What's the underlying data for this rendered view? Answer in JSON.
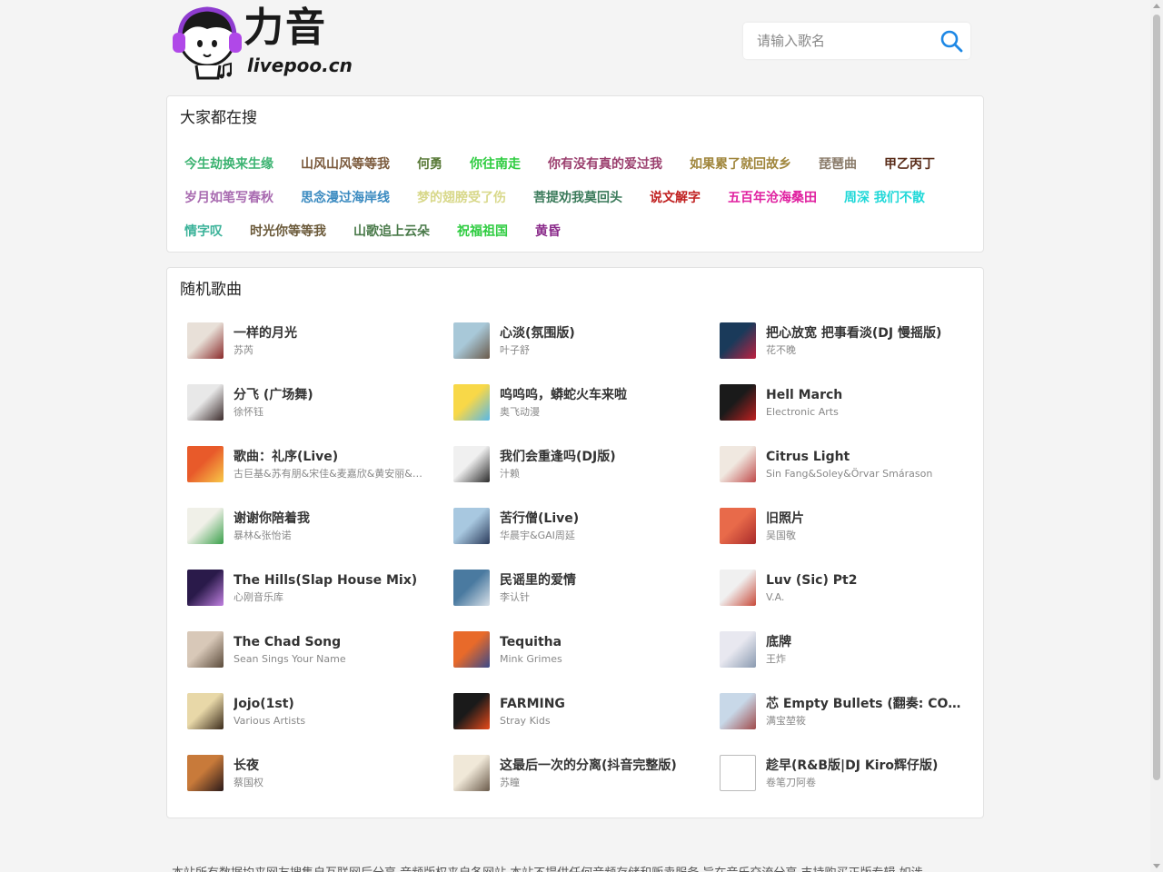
{
  "logo": {
    "title": "力音",
    "subtitle": "livepoo.cn"
  },
  "search": {
    "placeholder": "请输入歌名",
    "icon": "search-icon",
    "icon_color": "#1e88e5"
  },
  "hot": {
    "title": "大家都在搜",
    "rows": [
      [
        {
          "label": "今生劫换来生缘",
          "color": "#3cb371"
        },
        {
          "label": "山风山风等等我",
          "color": "#7b5a3c"
        },
        {
          "label": "何勇",
          "color": "#5b7b3a"
        },
        {
          "label": "你往南走",
          "color": "#2ecc40"
        },
        {
          "label": "你有没有真的爱过我",
          "color": "#9b3f6e"
        },
        {
          "label": "如果累了就回故乡",
          "color": "#a0863c"
        },
        {
          "label": "琵琶曲",
          "color": "#8a7b6a"
        },
        {
          "label": "甲乙丙丁",
          "color": "#5a2d1a"
        }
      ],
      [
        {
          "label": "岁月如笔写春秋",
          "color": "#a86ab0"
        },
        {
          "label": "思念漫过海岸线",
          "color": "#3a8ac0"
        },
        {
          "label": "梦的翅膀受了伤",
          "color": "#d8d88a"
        },
        {
          "label": "菩提劝我莫回头",
          "color": "#3a7a5a"
        },
        {
          "label": "说文解字",
          "color": "#c02020"
        },
        {
          "label": "五百年沧海桑田",
          "color": "#e020a0"
        },
        {
          "label": "周深 我们不散",
          "color": "#20d8d8"
        }
      ],
      [
        {
          "label": "情字叹",
          "color": "#3cb39a"
        },
        {
          "label": "时光你等等我",
          "color": "#6b5a3a"
        },
        {
          "label": "山歌追上云朵",
          "color": "#4a7a4a"
        },
        {
          "label": "祝福祖国",
          "color": "#2ecc40"
        },
        {
          "label": "黄昏",
          "color": "#8a2a8a"
        }
      ]
    ]
  },
  "random": {
    "title": "随机歌曲",
    "songs": [
      {
        "title": "一样的月光",
        "artist": "苏芮",
        "c1": "#e8e0d8",
        "c2": "#8a2a2a"
      },
      {
        "title": "心淡(氛围版)",
        "artist": "叶子舒",
        "c1": "#a8c8d8",
        "c2": "#6a5a4a"
      },
      {
        "title": "把心放宽 把事看淡(DJ 慢摇版)",
        "artist": "花不晚",
        "c1": "#1a3a5a",
        "c2": "#c02040"
      },
      {
        "title": "分飞 (广场舞)",
        "artist": "徐怀钰",
        "c1": "#e8e8e8",
        "c2": "#3a2a2a"
      },
      {
        "title": "呜呜呜，蟒蛇火车来啦",
        "artist": "奥飞动漫",
        "c1": "#f8d848",
        "c2": "#58b8e8"
      },
      {
        "title": "Hell March",
        "artist": "Electronic Arts",
        "c1": "#1a1a1a",
        "c2": "#c02020"
      },
      {
        "title": "歌曲：礼序(Live)",
        "artist": "古巨基&苏有朋&宋佳&麦嘉欣&黄安丽&王紫璇&沙宝亮&周深",
        "c1": "#e85a2a",
        "c2": "#f8c848"
      },
      {
        "title": "我们会重逢吗(DJ版)",
        "artist": "汁赖",
        "c1": "#f0f0f0",
        "c2": "#2a2a2a"
      },
      {
        "title": "Citrus Light",
        "artist": "Sin Fang&Soley&Örvar Smárason",
        "c1": "#f0e8e0",
        "c2": "#c04a4a"
      },
      {
        "title": "谢谢你陪着我",
        "artist": "暴林&张怡诺",
        "c1": "#f0f0e8",
        "c2": "#3aa04a"
      },
      {
        "title": "苦行僧(Live)",
        "artist": "华晨宇&GAI周延",
        "c1": "#a8c8e0",
        "c2": "#2a3a5a"
      },
      {
        "title": "旧照片",
        "artist": "吴国敬",
        "c1": "#e86a4a",
        "c2": "#a82a2a"
      },
      {
        "title": "The Hills(Slap House Mix)",
        "artist": "心刚音乐库",
        "c1": "#2a1a4a",
        "c2": "#c080e0"
      },
      {
        "title": "民谣里的爱情",
        "artist": "李认针",
        "c1": "#4a7aa0",
        "c2": "#d8e0e8"
      },
      {
        "title": "Luv (Sic) Pt2",
        "artist": "V.A.",
        "c1": "#f0f0f0",
        "c2": "#c84a3a"
      },
      {
        "title": "The Chad Song",
        "artist": "Sean Sings Your Name",
        "c1": "#d8c8b8",
        "c2": "#5a4a3a"
      },
      {
        "title": "Tequitha",
        "artist": "Mink Grimes",
        "c1": "#e86a2a",
        "c2": "#3a4a8a"
      },
      {
        "title": "底牌",
        "artist": "王炸",
        "c1": "#e8e8f0",
        "c2": "#8a9ab0"
      },
      {
        "title": "Jojo(1st)",
        "artist": "Various Artists",
        "c1": "#e8d8a8",
        "c2": "#3a2a1a"
      },
      {
        "title": "FARMING",
        "artist": "Stray Kids",
        "c1": "#1a1a1a",
        "c2": "#e84a1a"
      },
      {
        "title": "芯 Empty Bullets (翻奏: CORSAK胡梦周)",
        "artist": "满宝堃筱",
        "c1": "#c8d8e8",
        "c2": "#a04a4a"
      },
      {
        "title": "长夜",
        "artist": "蔡国权",
        "c1": "#c87a3a",
        "c2": "#2a1a1a"
      },
      {
        "title": "这最后一次的分离(抖音完整版)",
        "artist": "苏瞳",
        "c1": "#f0e8d8",
        "c2": "#6a5a4a"
      },
      {
        "title": "趁早(R&B版|DJ Kiro辉仔版)",
        "artist": "卷笔刀阿卷",
        "c1": "#ffffff",
        "c2": "#cccccc"
      }
    ]
  },
  "footer": {
    "text": "本站所有数据均来网友搜集自互联网后分享,音频版权来自各网站,本站不提供任何音频存储和贩卖服务,旨在音乐交流分享,支持购买正版专辑,如涉"
  }
}
